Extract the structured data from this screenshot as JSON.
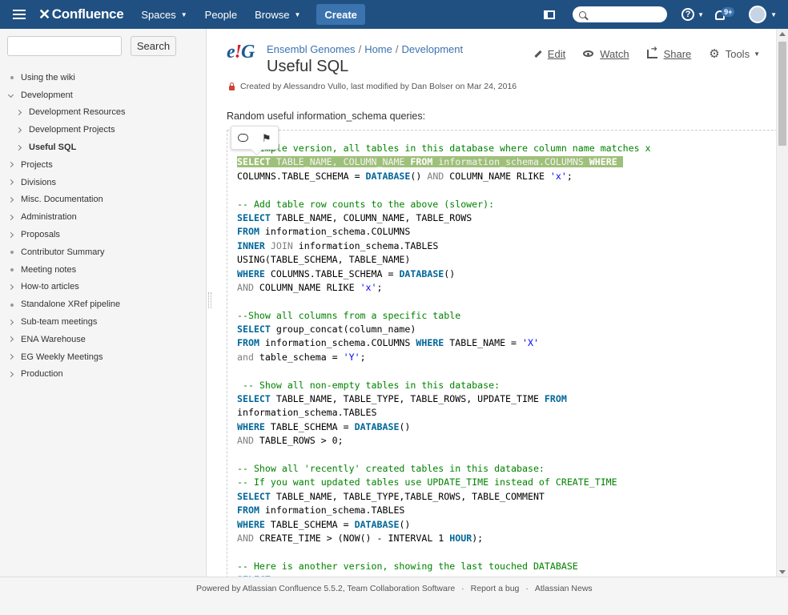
{
  "header": {
    "logo_text": "Confluence",
    "nav": {
      "spaces": "Spaces",
      "people": "People",
      "browse": "Browse"
    },
    "create_label": "Create",
    "help_glyph": "?",
    "notifications_badge": "9+",
    "colors": {
      "bar": "#205081",
      "create_button": "#3b73af"
    }
  },
  "sidebar": {
    "search_placeholder": "",
    "search_button": "Search",
    "tree": [
      {
        "label": "Using the wiki",
        "marker": "dot",
        "level": 0
      },
      {
        "label": "Development",
        "marker": "expanded",
        "level": 0
      },
      {
        "label": "Development Resources",
        "marker": "collapsed",
        "level": 1
      },
      {
        "label": "Development Projects",
        "marker": "collapsed",
        "level": 1
      },
      {
        "label": "Useful SQL",
        "marker": "collapsed",
        "level": 1,
        "current": true
      },
      {
        "label": "Projects",
        "marker": "collapsed",
        "level": 0
      },
      {
        "label": "Divisions",
        "marker": "collapsed",
        "level": 0
      },
      {
        "label": "Misc. Documentation",
        "marker": "collapsed",
        "level": 0
      },
      {
        "label": "Administration",
        "marker": "collapsed",
        "level": 0
      },
      {
        "label": "Proposals",
        "marker": "collapsed",
        "level": 0
      },
      {
        "label": "Contributor Summary",
        "marker": "dot",
        "level": 0
      },
      {
        "label": "Meeting notes",
        "marker": "dot",
        "level": 0
      },
      {
        "label": "How-to articles",
        "marker": "collapsed",
        "level": 0
      },
      {
        "label": "Standalone XRef pipeline",
        "marker": "dot",
        "level": 0
      },
      {
        "label": "Sub-team meetings",
        "marker": "collapsed",
        "level": 0
      },
      {
        "label": "ENA Warehouse",
        "marker": "collapsed",
        "level": 0
      },
      {
        "label": "EG Weekly Meetings",
        "marker": "collapsed",
        "level": 0
      },
      {
        "label": "Production",
        "marker": "collapsed",
        "level": 0
      }
    ]
  },
  "page": {
    "space_logo": {
      "left": "e",
      "mark": "!",
      "right": "G"
    },
    "breadcrumbs": [
      "Ensembl Genomes",
      "Home",
      "Development"
    ],
    "title": "Useful SQL",
    "actions": {
      "edit": "Edit",
      "watch": "Watch",
      "share": "Share",
      "tools": "Tools"
    },
    "byline": "Created by Alessandro Vullo, last modified by Dan Bolser on Mar 24, 2016",
    "intro": "Random useful information_schema queries:",
    "code_lines": [
      [
        [
          "cm",
          "-- Simple version, all tables in this database where column name matches x"
        ]
      ],
      [
        [
          "hl",
          "SELECT TABLE_NAME, COLUMN_NAME FROM information_schema.COLUMNS WHERE "
        ]
      ],
      [
        [
          "tx",
          "COLUMNS.TABLE_SCHEMA = "
        ],
        [
          "kw",
          "DATABASE"
        ],
        [
          "tx",
          "() "
        ],
        [
          "kg",
          "AND"
        ],
        [
          "tx",
          " COLUMN_NAME RLIKE "
        ],
        [
          "st",
          "'x'"
        ],
        [
          "tx",
          ";"
        ]
      ],
      [],
      [
        [
          "cm",
          "-- Add table row counts to the above (slower):"
        ]
      ],
      [
        [
          "kw",
          "SELECT"
        ],
        [
          "tx",
          " TABLE_NAME, COLUMN_NAME, TABLE_ROWS"
        ]
      ],
      [
        [
          "kw",
          "FROM"
        ],
        [
          "tx",
          " information_schema.COLUMNS"
        ]
      ],
      [
        [
          "kw",
          "INNER"
        ],
        [
          "tx",
          " "
        ],
        [
          "kg",
          "JOIN"
        ],
        [
          "tx",
          " information_schema.TABLES"
        ]
      ],
      [
        [
          "tx",
          "USING(TABLE_SCHEMA, TABLE_NAME)"
        ]
      ],
      [
        [
          "kw",
          "WHERE"
        ],
        [
          "tx",
          " COLUMNS.TABLE_SCHEMA = "
        ],
        [
          "kw",
          "DATABASE"
        ],
        [
          "tx",
          "()"
        ]
      ],
      [
        [
          "kg",
          "AND"
        ],
        [
          "tx",
          " COLUMN_NAME RLIKE "
        ],
        [
          "st",
          "'x'"
        ],
        [
          "tx",
          ";"
        ]
      ],
      [],
      [
        [
          "cm",
          "--Show all columns from a specific table"
        ]
      ],
      [
        [
          "kw",
          "SELECT"
        ],
        [
          "tx",
          " group_concat(column_name)"
        ]
      ],
      [
        [
          "kw",
          "FROM"
        ],
        [
          "tx",
          " information_schema.COLUMNS "
        ],
        [
          "kw",
          "WHERE"
        ],
        [
          "tx",
          " TABLE_NAME = "
        ],
        [
          "st",
          "'X'"
        ]
      ],
      [
        [
          "kg",
          "and"
        ],
        [
          "tx",
          " table_schema = "
        ],
        [
          "st",
          "'Y'"
        ],
        [
          "tx",
          ";"
        ]
      ],
      [],
      [
        [
          "cm",
          " -- Show all non-empty tables in this database:"
        ]
      ],
      [
        [
          "kw",
          "SELECT"
        ],
        [
          "tx",
          " TABLE_NAME, TABLE_TYPE, TABLE_ROWS, UPDATE_TIME "
        ],
        [
          "kw",
          "FROM"
        ]
      ],
      [
        [
          "tx",
          "information_schema.TABLES"
        ]
      ],
      [
        [
          "kw",
          "WHERE"
        ],
        [
          "tx",
          " TABLE_SCHEMA = "
        ],
        [
          "kw",
          "DATABASE"
        ],
        [
          "tx",
          "()"
        ]
      ],
      [
        [
          "kg",
          "AND"
        ],
        [
          "tx",
          " TABLE_ROWS > 0;"
        ]
      ],
      [],
      [
        [
          "cm",
          "-- Show all 'recently' created tables in this database:"
        ]
      ],
      [
        [
          "cm",
          "-- If you want updated tables use UPDATE_TIME instead of CREATE_TIME"
        ]
      ],
      [
        [
          "kw",
          "SELECT"
        ],
        [
          "tx",
          " TABLE_NAME, TABLE_TYPE,TABLE_ROWS, TABLE_COMMENT"
        ]
      ],
      [
        [
          "kw",
          "FROM"
        ],
        [
          "tx",
          " information_schema.TABLES"
        ]
      ],
      [
        [
          "kw",
          "WHERE"
        ],
        [
          "tx",
          " TABLE_SCHEMA = "
        ],
        [
          "kw",
          "DATABASE"
        ],
        [
          "tx",
          "()"
        ]
      ],
      [
        [
          "kg",
          "AND"
        ],
        [
          "tx",
          " CREATE_TIME > (NOW() - INTERVAL 1 "
        ],
        [
          "kw",
          "HOUR"
        ],
        [
          "tx",
          ");"
        ]
      ],
      [],
      [
        [
          "cm",
          "-- Here is another version, showing the last touched DATABASE"
        ]
      ],
      [
        [
          "kw",
          "SELECT"
        ]
      ]
    ],
    "highlight_color": "#9fc07a"
  },
  "footer": {
    "powered_by": "Powered by Atlassian Confluence 5.5.2, Team Collaboration Software",
    "report_bug": "Report a bug",
    "news": "Atlassian News",
    "separator": "·"
  }
}
